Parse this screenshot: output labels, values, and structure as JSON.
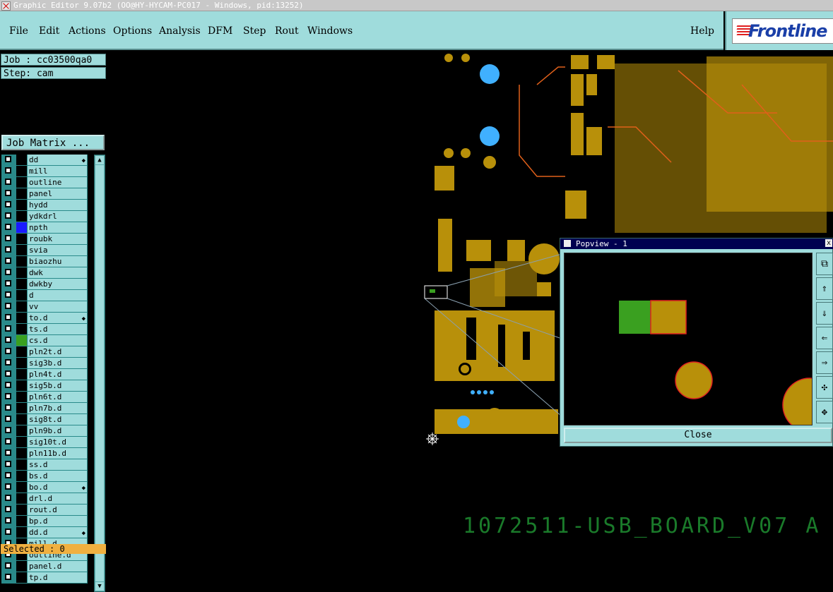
{
  "window": {
    "title": "Graphic Editor 9.07b2 (OO@HY-HYCAM-PC017 - Windows, pid:13252)"
  },
  "menu": {
    "items": [
      "File",
      "Edit",
      "Actions",
      "Options",
      "Analysis",
      "DFM",
      "Step",
      "Rout",
      "Windows"
    ],
    "help": "Help"
  },
  "logo": {
    "text": "Frontline"
  },
  "job": {
    "label": "Job : cc03500qa0",
    "step": "Step: cam",
    "matrix_button": "Job Matrix ..."
  },
  "layers": [
    {
      "name": "dd",
      "color": "#000000",
      "mark": true
    },
    {
      "name": "mill",
      "color": "#000000",
      "mark": false
    },
    {
      "name": "outline",
      "color": "#000000",
      "mark": false
    },
    {
      "name": "panel",
      "color": "#000000",
      "mark": false
    },
    {
      "name": "hydd",
      "color": "#000000",
      "mark": false
    },
    {
      "name": "ydkdrl",
      "color": "#000000",
      "mark": false
    },
    {
      "name": "npth",
      "color": "#1a1aff",
      "mark": false
    },
    {
      "name": "roubk",
      "color": "#000000",
      "mark": false
    },
    {
      "name": "svia",
      "color": "#000000",
      "mark": false
    },
    {
      "name": "biaozhu",
      "color": "#000000",
      "mark": false
    },
    {
      "name": "dwk",
      "color": "#000000",
      "mark": false
    },
    {
      "name": "dwkby",
      "color": "#000000",
      "mark": false
    },
    {
      "name": "d",
      "color": "#000000",
      "mark": false
    },
    {
      "name": "vv",
      "color": "#000000",
      "mark": false
    },
    {
      "name": "to.d",
      "color": "#000000",
      "mark": true
    },
    {
      "name": "ts.d",
      "color": "#000000",
      "mark": false
    },
    {
      "name": "cs.d",
      "color": "#3aa020",
      "mark": false
    },
    {
      "name": "pln2t.d",
      "color": "#000000",
      "mark": false
    },
    {
      "name": "sig3b.d",
      "color": "#000000",
      "mark": false
    },
    {
      "name": "pln4t.d",
      "color": "#000000",
      "mark": false
    },
    {
      "name": "sig5b.d",
      "color": "#000000",
      "mark": false
    },
    {
      "name": "pln6t.d",
      "color": "#000000",
      "mark": false
    },
    {
      "name": "pln7b.d",
      "color": "#000000",
      "mark": false
    },
    {
      "name": "sig8t.d",
      "color": "#000000",
      "mark": false
    },
    {
      "name": "pln9b.d",
      "color": "#000000",
      "mark": false
    },
    {
      "name": "sig10t.d",
      "color": "#000000",
      "mark": false
    },
    {
      "name": "pln11b.d",
      "color": "#000000",
      "mark": false
    },
    {
      "name": "ss.d",
      "color": "#000000",
      "mark": false
    },
    {
      "name": "bs.d",
      "color": "#000000",
      "mark": false
    },
    {
      "name": "bo.d",
      "color": "#000000",
      "mark": true
    },
    {
      "name": "drl.d",
      "color": "#000000",
      "mark": false
    },
    {
      "name": "rout.d",
      "color": "#000000",
      "mark": false
    },
    {
      "name": "bp.d",
      "color": "#000000",
      "mark": false
    },
    {
      "name": "dd.d",
      "color": "#000000",
      "mark": true
    },
    {
      "name": "mill.d",
      "color": "#000000",
      "mark": false
    },
    {
      "name": "outline.d",
      "color": "#000000",
      "mark": false
    },
    {
      "name": "panel.d",
      "color": "#000000",
      "mark": false
    },
    {
      "name": "tp.d",
      "color": "#000000",
      "mark": false
    }
  ],
  "status": {
    "selected": "Selected : 0"
  },
  "popview": {
    "title": "Popview - 1",
    "close_label": "Close",
    "close_x": "x"
  },
  "board": {
    "label": "1072511-USB_BOARD_V07 A"
  },
  "colors": {
    "panel": "#9fdcdc",
    "copper": "#b8900a",
    "fill_green": "#3aa020",
    "hole": "#40b0ff",
    "outline_red": "#e02020"
  }
}
